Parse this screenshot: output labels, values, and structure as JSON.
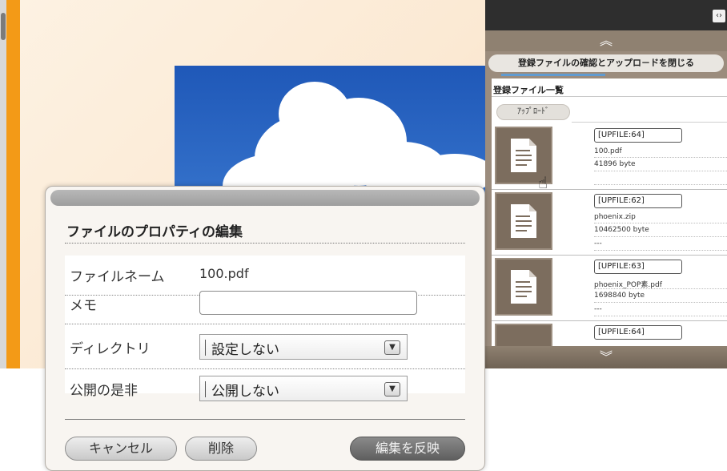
{
  "panel": {
    "toggle_icon": "code-toggle-icon",
    "collapse_icon": "double-chevron-up-icon",
    "expand_icon": "double-chevron-down-icon",
    "close_label": "登録ファイルの確認とアップロ－ドを閉じる",
    "list_title": "登録ファイル一覧",
    "upload_label": "ｱｯﾌﾟﾛｰﾄﾞ",
    "files": [
      {
        "code": "[UPFILE:64]",
        "name": "100.pdf",
        "size": "41896 byte",
        "memo": ""
      },
      {
        "code": "[UPFILE:62]",
        "name": "phoenix.zip",
        "size": "10462500 byte",
        "memo": "---"
      },
      {
        "code": "[UPFILE:63]",
        "name": "phoenix_POP素.pdf",
        "size": "1698840 byte",
        "memo": "---"
      },
      {
        "code": "[UPFILE:64]",
        "name": "",
        "size": "",
        "memo": ""
      }
    ]
  },
  "dialog": {
    "title": "ファイルのプロパティの編集",
    "filename_label": "ファイルネーム",
    "filename_value": "100.pdf",
    "memo_label": "メモ",
    "memo_value": "",
    "directory_label": "ディレクトリ",
    "directory_selected": "設定しない",
    "visibility_label": "公開の是非",
    "visibility_selected": "公開しない",
    "cancel_label": "キャンセル",
    "delete_label": "削除",
    "apply_label": "編集を反映"
  },
  "colors": {
    "accent_orange": "#f39a17",
    "panel_brown": "#9b8c7d",
    "thumb_brown": "#7c6d5e"
  }
}
